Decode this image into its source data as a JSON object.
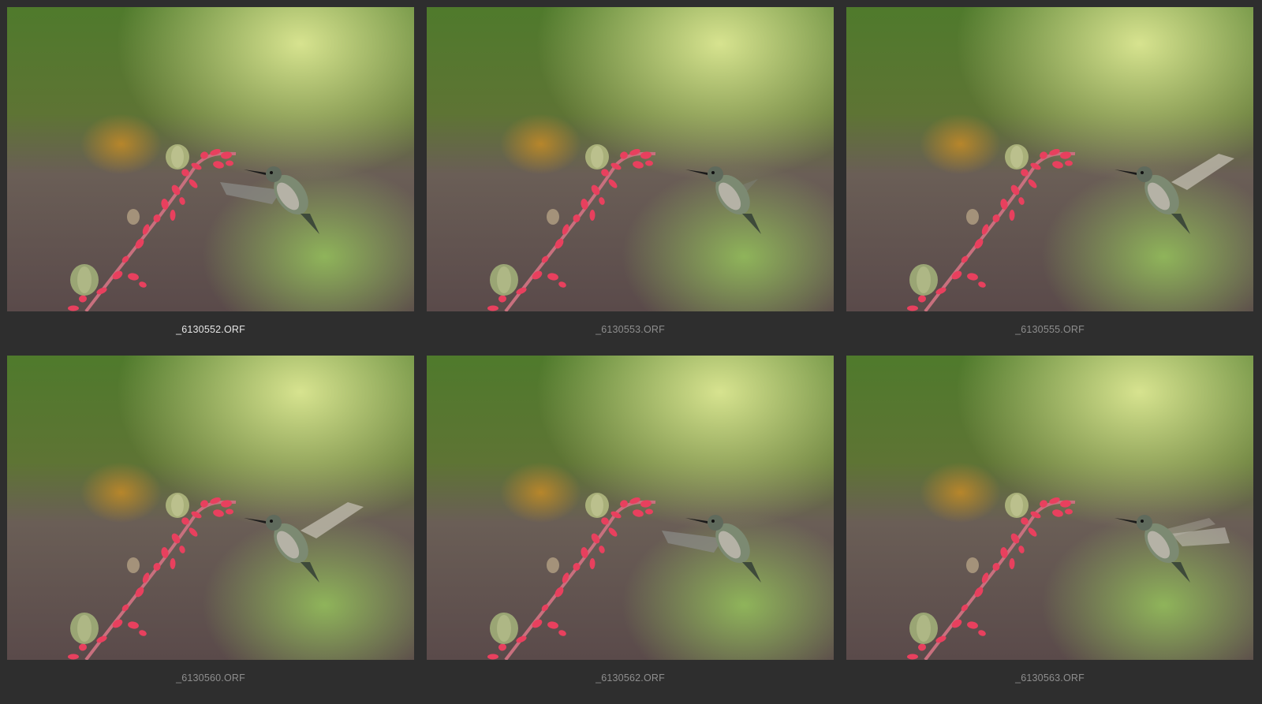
{
  "browser": {
    "thumbnails": [
      {
        "filename": "_6130552.ORF",
        "selected": true,
        "bird": "hover-left-wing"
      },
      {
        "filename": "_6130553.ORF",
        "selected": false,
        "bird": "feeding-wings-back"
      },
      {
        "filename": "_6130555.ORF",
        "selected": false,
        "bird": "wings-up"
      },
      {
        "filename": "_6130560.ORF",
        "selected": false,
        "bird": "wings-up"
      },
      {
        "filename": "_6130562.ORF",
        "selected": false,
        "bird": "hover-left-wing"
      },
      {
        "filename": "_6130563.ORF",
        "selected": false,
        "bird": "wings-blur"
      }
    ]
  },
  "colors": {
    "background": "#2e2e2e",
    "caption_normal": "#8e8e8e",
    "caption_selected": "#e6e6e6",
    "flower": "#e8405e"
  }
}
